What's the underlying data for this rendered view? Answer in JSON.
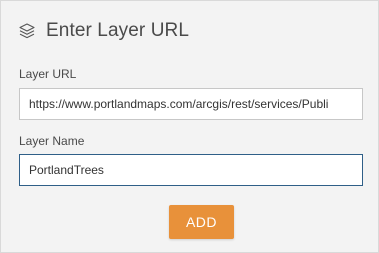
{
  "header": {
    "title": "Enter Layer URL",
    "icon": "layers-icon"
  },
  "layer_url": {
    "label": "Layer URL",
    "value": "https://www.portlandmaps.com/arcgis/rest/services/Publi"
  },
  "layer_name": {
    "label": "Layer Name",
    "value": "PortlandTrees"
  },
  "add_button": {
    "label": "ADD",
    "color": "#e8913a"
  },
  "colors": {
    "panel_bg": "#f3f3f3",
    "focus_border": "#2f5f88"
  }
}
